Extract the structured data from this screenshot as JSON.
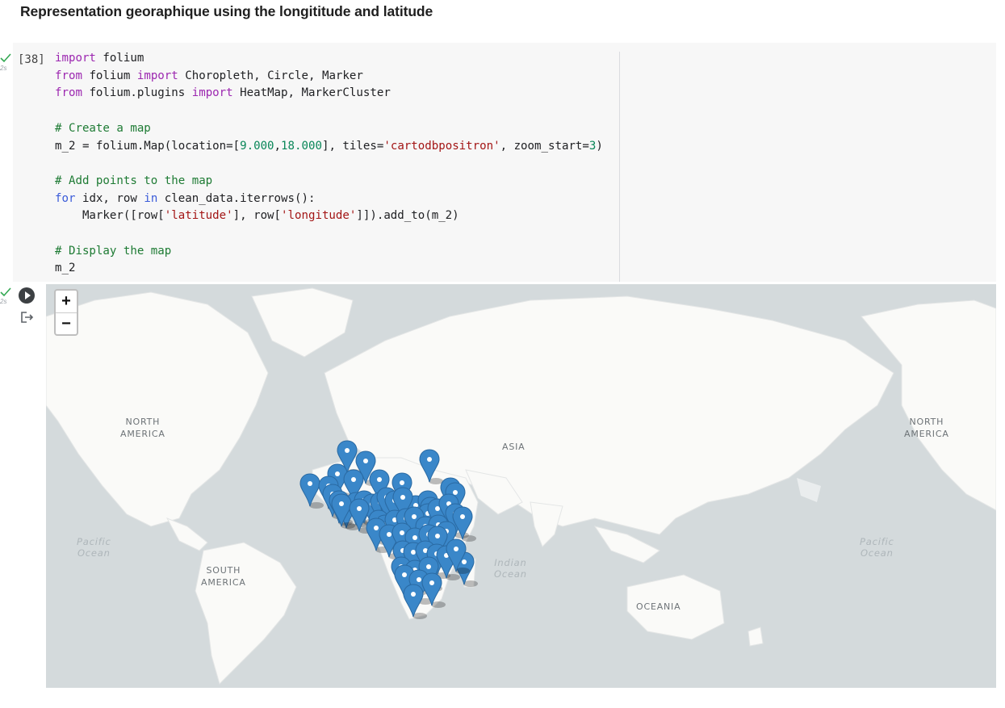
{
  "heading": "Representation georaphique using the longititude and latitude",
  "cell": {
    "exec_count": "[38]",
    "time": "2s",
    "code": {
      "l1_kw": "import",
      "l1_rest": " folium",
      "l2_from": "from",
      "l2_mod": " folium ",
      "l2_imp": "import",
      "l2_rest": " Choropleth, Circle, Marker",
      "l3_from": "from",
      "l3_mod": " folium.plugins ",
      "l3_imp": "import",
      "l3_rest": " HeatMap, MarkerCluster",
      "l5_comment": "# Create a map",
      "l6_a": "m_2 = folium.Map(location=[",
      "l6_n1": "9.000",
      "l6_b": ",",
      "l6_n2": "18.000",
      "l6_c": "], tiles=",
      "l6_str": "'cartodbpositron'",
      "l6_d": ", zoom_start=",
      "l6_n3": "3",
      "l6_e": ")",
      "l8_comment": "# Add points to the map",
      "l9_for": "for",
      "l9_a": " idx, row ",
      "l9_in": "in",
      "l9_b": " clean_data.iterrows():",
      "l10_a": "    Marker([row[",
      "l10_s1": "'latitude'",
      "l10_b": "], row[",
      "l10_s2": "'longitude'",
      "l10_c": "]]).add_to(m_2)",
      "l12_comment": "# Display the map",
      "l13": "m_2"
    }
  },
  "output": {
    "time": "2s"
  },
  "map": {
    "zoom_in": "+",
    "zoom_out": "−",
    "labels": {
      "north_america_left": "NORTH\nAMERICA",
      "north_america_right": "NORTH\nAMERICA",
      "asia": "ASIA",
      "south_america": "SOUTH\nAMERICA",
      "oceania": "OCEANIA",
      "pacific_left": "Pacific\nOcean",
      "pacific_right": "Pacific\nOcean",
      "indian": "Indian\nOcean"
    },
    "colors": {
      "water": "#d4dadc",
      "land": "#fafaf8",
      "marker": "#3a87c9"
    },
    "marker_count": 62
  }
}
